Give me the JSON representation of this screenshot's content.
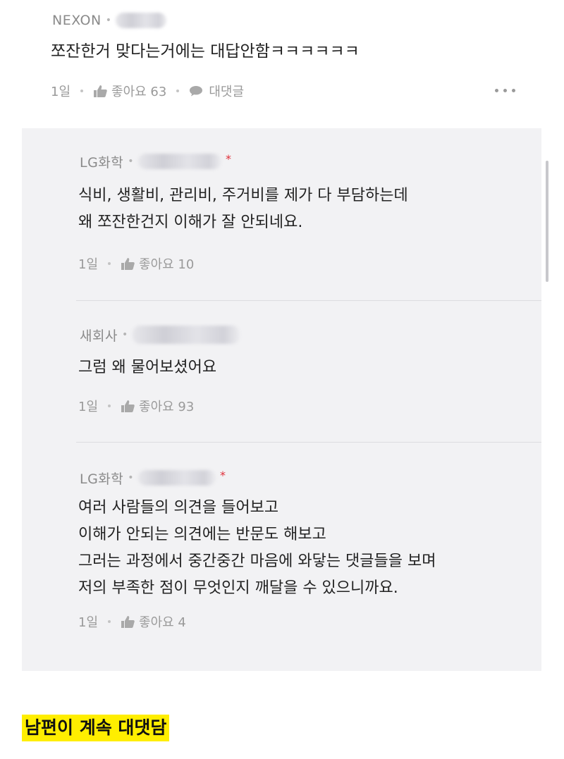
{
  "comment": {
    "author": "NEXON",
    "text": "쪼잔한거 맞다는거에는 대답안함ㅋㅋㅋㅋㅋㅋ",
    "time": "1일",
    "like_label": "좋아요 63",
    "reply_label": "대댓글"
  },
  "replies": [
    {
      "author": "LG화학",
      "lines": [
        "식비, 생활비, 관리비, 주거비를 제가 다 부담하는데",
        "왜 쪼잔한건지 이해가 잘 안되네요."
      ],
      "time": "1일",
      "like_label": "좋아요 10"
    },
    {
      "author": "새회사",
      "lines": [
        "그럼 왜 물어보셨어요"
      ],
      "time": "1일",
      "like_label": "좋아요 93"
    },
    {
      "author": "LG화학",
      "lines": [
        "여러 사람들의 의견을 들어보고",
        "이해가 안되는 의견에는 반문도 해보고",
        "그러는 과정에서 중간중간 마음에 와닿는 댓글들을 보며",
        "저의 부족한 점이 무엇인지 깨달을 수 있으니까요."
      ],
      "time": "1일",
      "like_label": "좋아요 4"
    }
  ],
  "caption": "남편이 계속 대댓담",
  "icons": {
    "like": "thumbs-up-icon",
    "reply": "speech-bubble-icon",
    "more": "more-dots-icon",
    "op_marker": "asterisk-icon"
  },
  "colors": {
    "panel_bg": "#f2f2f4",
    "caption_highlight": "#ffee00",
    "op_marker": "#e0303a"
  }
}
